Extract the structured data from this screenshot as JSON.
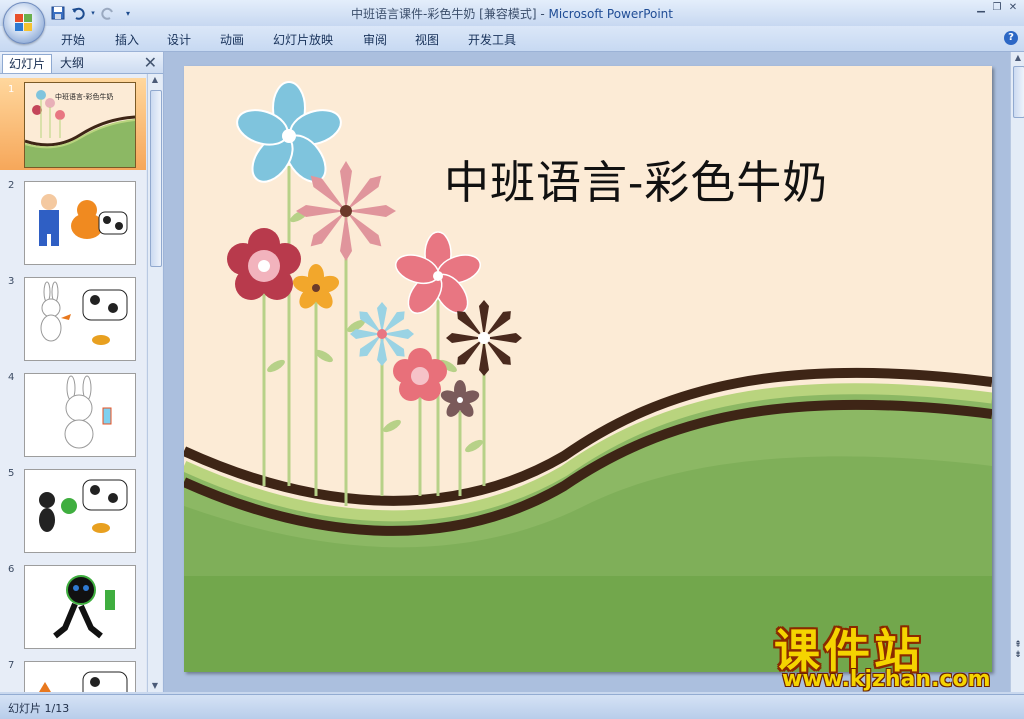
{
  "window": {
    "title_doc": "中班语言课件-彩色牛奶 [兼容模式] - ",
    "title_app": "Microsoft PowerPoint"
  },
  "quick_access": {
    "save_icon": "save-icon",
    "undo_icon": "undo-icon",
    "redo_icon": "redo-icon",
    "customize_icon": "customize-qat-icon"
  },
  "ribbon": {
    "tabs": [
      {
        "label": "开始"
      },
      {
        "label": "插入"
      },
      {
        "label": "设计"
      },
      {
        "label": "动画"
      },
      {
        "label": "幻灯片放映"
      },
      {
        "label": "审阅"
      },
      {
        "label": "视图"
      },
      {
        "label": "开发工具"
      }
    ],
    "help": "?"
  },
  "panel": {
    "tab_slides": "幻灯片",
    "tab_outline": "大纲",
    "close": "✕",
    "thumbnails": [
      {
        "num": "1",
        "selected": true,
        "caption": "中班语言-彩色牛奶"
      },
      {
        "num": "2",
        "selected": false
      },
      {
        "num": "3",
        "selected": false
      },
      {
        "num": "4",
        "selected": false
      },
      {
        "num": "5",
        "selected": false
      },
      {
        "num": "6",
        "selected": false
      },
      {
        "num": "7",
        "selected": false
      }
    ]
  },
  "slide": {
    "title": "中班语言-彩色牛奶",
    "colors": {
      "background": "#fcebd6",
      "grass": "#8cb864",
      "stripe_dark": "#3e2516",
      "stripe_light": "#b9d47e"
    }
  },
  "status": {
    "slide_indicator": "幻灯片 1/13"
  },
  "watermark": {
    "brand": "课件站",
    "url": "www.kjzhan.com"
  }
}
